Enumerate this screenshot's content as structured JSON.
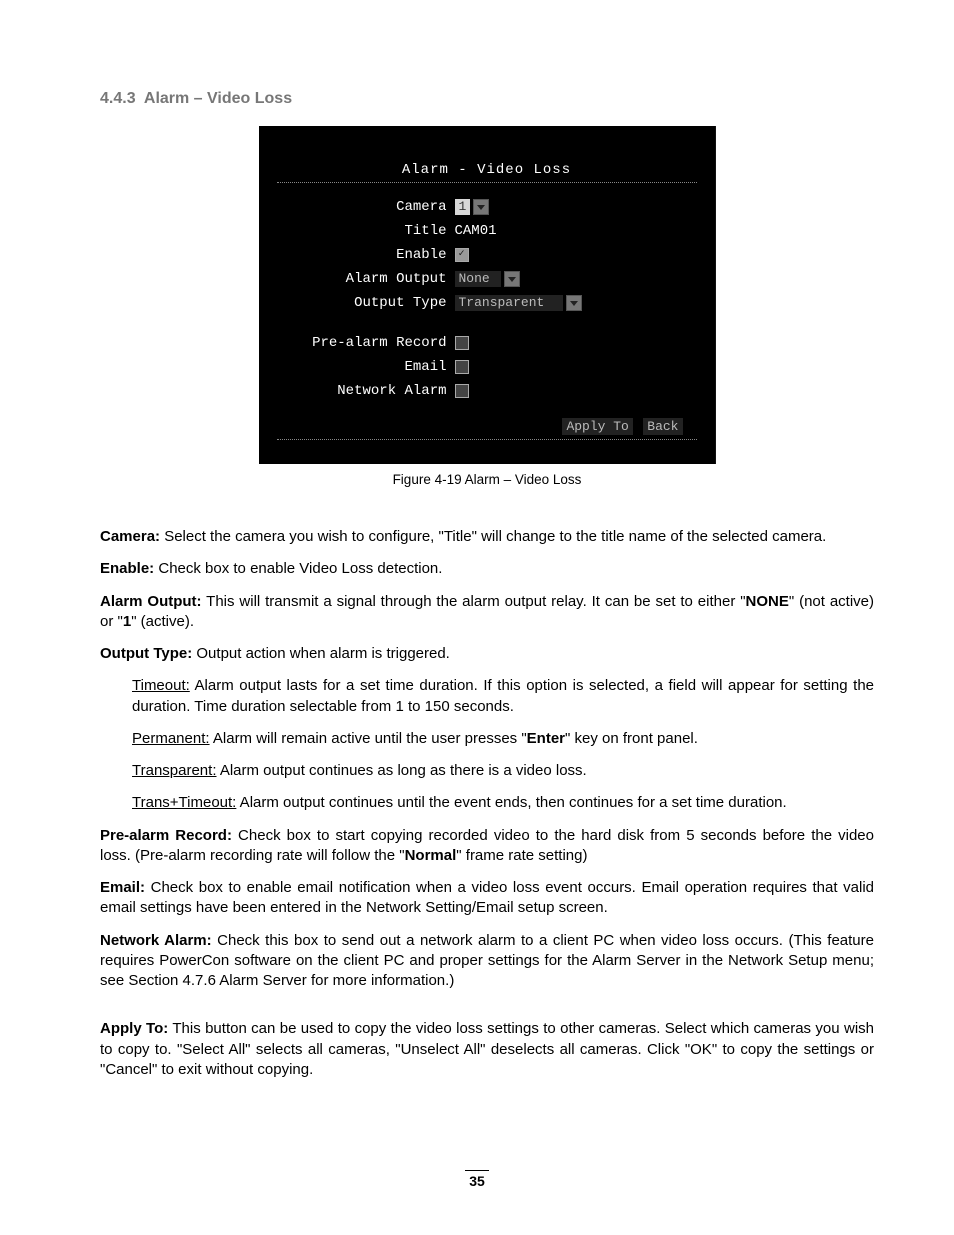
{
  "heading": "4.4.3  Alarm – Video Loss",
  "screenshot": {
    "title": "Alarm - Video Loss",
    "rows": {
      "camera_label": "Camera",
      "camera_value": "1",
      "title_label": "Title",
      "title_value": "CAM01",
      "enable_label": "Enable",
      "alarm_output_label": "Alarm Output",
      "alarm_output_value": "None",
      "output_type_label": "Output Type",
      "output_type_value": "Transparent",
      "prealarm_label": "Pre-alarm Record",
      "email_label": "Email",
      "network_label": "Network Alarm"
    },
    "buttons": {
      "apply": "Apply To",
      "back": "Back"
    }
  },
  "caption": "Figure 4-19 Alarm – Video Loss",
  "text": {
    "camera_b": "Camera:",
    "camera_t": " Select the camera you wish to configure, \"Title\" will change to the title name of the selected camera.",
    "enable_b": "Enable:",
    "enable_t": " Check box to enable Video Loss detection.",
    "alarm_b": "Alarm Output:",
    "alarm_t1": " This will transmit a signal through the alarm output relay. It can be set to either \"",
    "alarm_none": "NONE",
    "alarm_t2": "\" (not active) or \"",
    "alarm_one": "1",
    "alarm_t3": "\" (active).",
    "output_b": "Output Type:",
    "output_t": " Output action when alarm is triggered.",
    "timeout_u": "Timeout:",
    "timeout_t": " Alarm output lasts for a set time duration. If this option is selected, a field will appear for setting the duration. Time duration selectable from 1 to 150 seconds.",
    "perm_u": "Permanent:",
    "perm_t1": " Alarm will remain active until the user presses \"",
    "perm_enter": "Enter",
    "perm_t2": "\" key on front panel.",
    "trans_u": "Transparent:",
    "trans_t": " Alarm output continues as long as there is a video loss.",
    "tt_u": "Trans+Timeout:",
    "tt_t": " Alarm output continues until the event ends, then continues for a set time duration.",
    "pre_b": "Pre-alarm Record:",
    "pre_t1": " Check box to start copying recorded video to the hard disk from 5 seconds before the video loss. (Pre-alarm recording rate will follow the \"",
    "pre_normal": "Normal",
    "pre_t2": "\" frame rate setting)",
    "email_b": "Email:",
    "email_t": " Check box to enable email notification when a video loss event occurs. Email operation requires that valid email settings have been entered in the Network Setting/Email setup screen.",
    "net_b": "Network Alarm:",
    "net_t": " Check this box to send out a network alarm to a client PC when video loss occurs. (This feature requires PowerCon software on the client PC and proper settings for the Alarm Server in the Network Setup menu; see Section 4.7.6 Alarm Server for more information.)",
    "apply_b": "Apply To:",
    "apply_t": " This button can be used to copy the video loss settings to other cameras. Select which cameras you wish to copy to. \"Select All\" selects all cameras, \"Unselect All\" deselects all cameras. Click \"OK\" to copy the settings or \"Cancel\" to exit without copying."
  },
  "page_number": "35"
}
